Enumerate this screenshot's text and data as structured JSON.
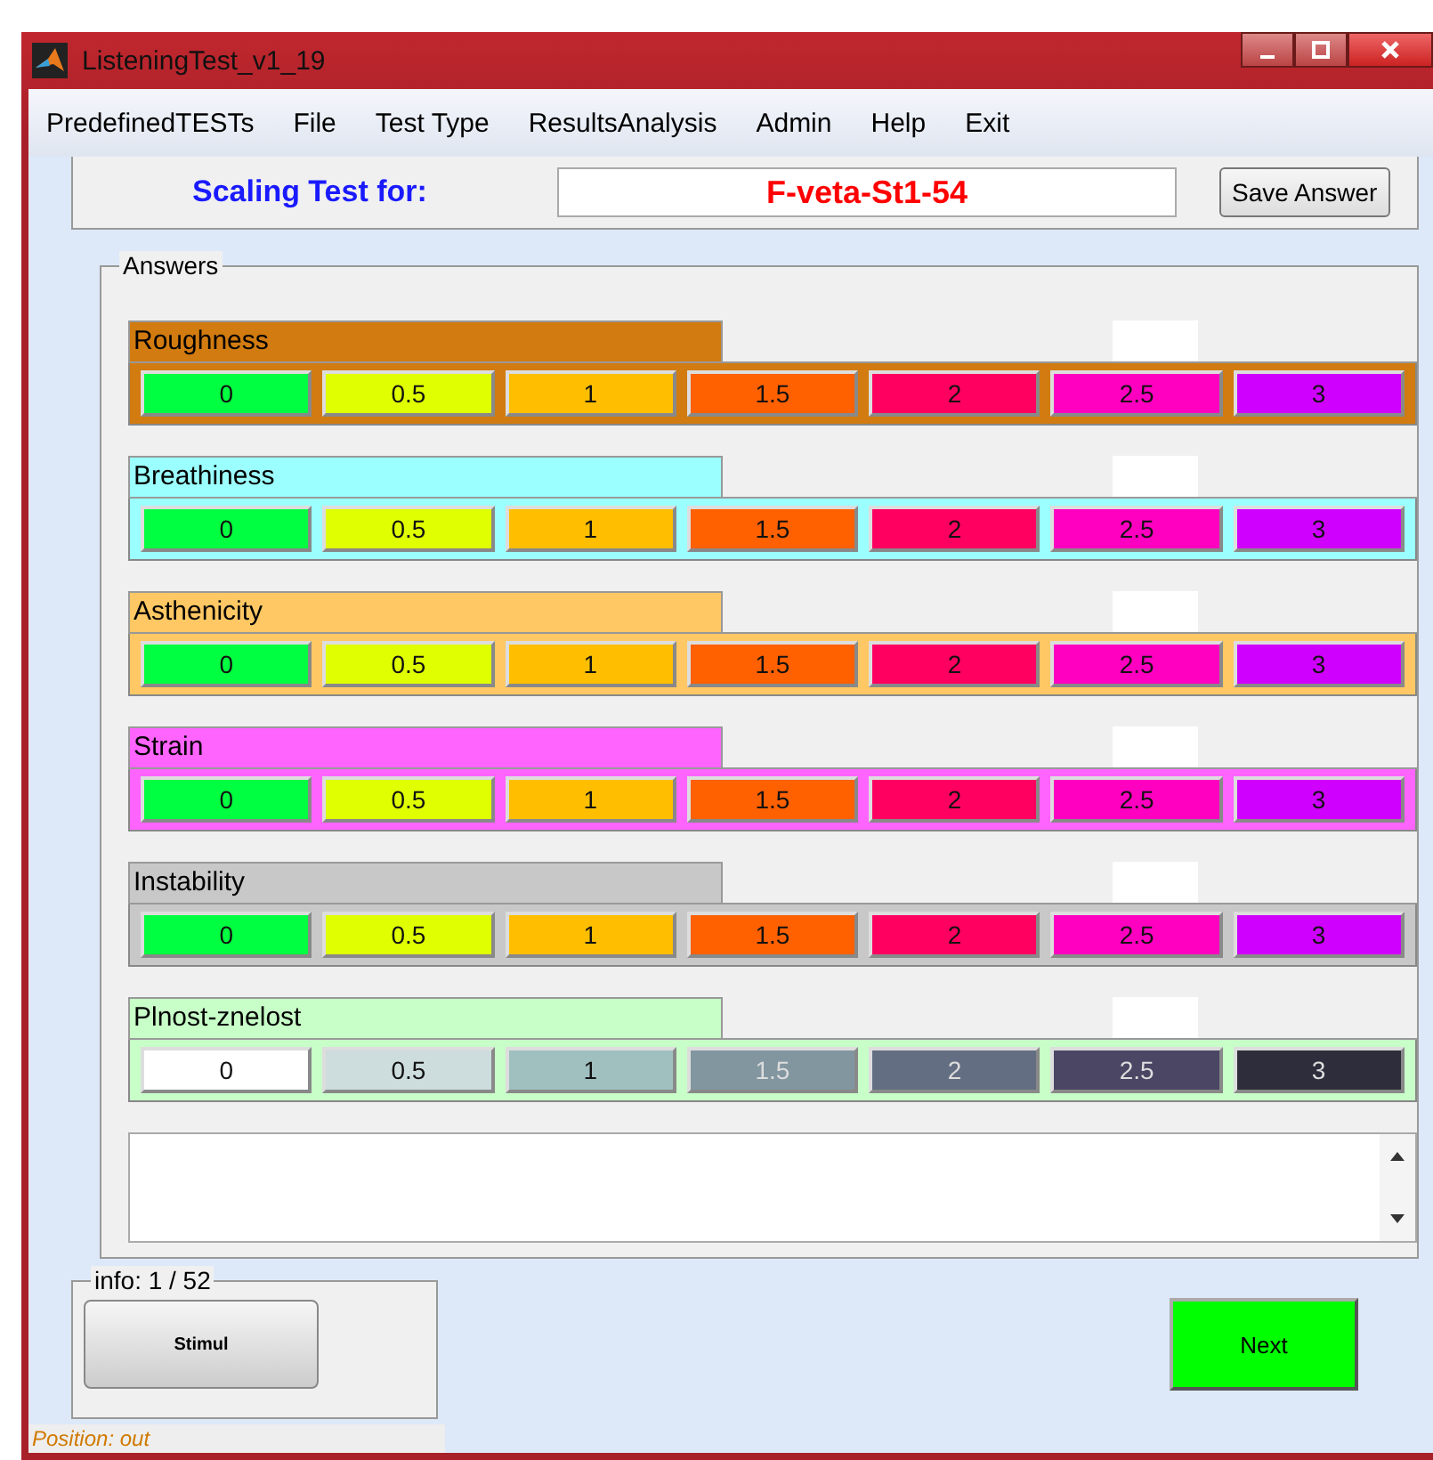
{
  "window": {
    "title": "ListeningTest_v1_19"
  },
  "menu": [
    "PredefinedTESTs",
    "File",
    "Test Type",
    "ResultsAnalysis",
    "Admin",
    "Help",
    "Exit"
  ],
  "general": {
    "label": "Scaling Test for:",
    "value": "F-veta-St1-54",
    "save_button": "Save Answer"
  },
  "answers": {
    "title": "Answers",
    "scales": [
      {
        "name": "Roughness",
        "color": "#d17b10",
        "options": [
          {
            "label": "0",
            "color": "#00ff40"
          },
          {
            "label": "0.5",
            "color": "#e0ff00"
          },
          {
            "label": "1",
            "color": "#ffbf00"
          },
          {
            "label": "1.5",
            "color": "#ff6000"
          },
          {
            "label": "2",
            "color": "#ff0060"
          },
          {
            "label": "2.5",
            "color": "#ff00c0"
          },
          {
            "label": "3",
            "color": "#d000ff"
          }
        ]
      },
      {
        "name": "Breathiness",
        "color": "#9cffff",
        "options": [
          {
            "label": "0",
            "color": "#00ff40"
          },
          {
            "label": "0.5",
            "color": "#e0ff00"
          },
          {
            "label": "1",
            "color": "#ffbf00"
          },
          {
            "label": "1.5",
            "color": "#ff6000"
          },
          {
            "label": "2",
            "color": "#ff0060"
          },
          {
            "label": "2.5",
            "color": "#ff00c0"
          },
          {
            "label": "3",
            "color": "#d000ff"
          }
        ]
      },
      {
        "name": "Asthenicity",
        "color": "#ffc864",
        "options": [
          {
            "label": "0",
            "color": "#00ff40"
          },
          {
            "label": "0.5",
            "color": "#e0ff00"
          },
          {
            "label": "1",
            "color": "#ffbf00"
          },
          {
            "label": "1.5",
            "color": "#ff6000"
          },
          {
            "label": "2",
            "color": "#ff0060"
          },
          {
            "label": "2.5",
            "color": "#ff00c0"
          },
          {
            "label": "3",
            "color": "#d000ff"
          }
        ]
      },
      {
        "name": "Strain",
        "color": "#ff64ff",
        "options": [
          {
            "label": "0",
            "color": "#00ff40"
          },
          {
            "label": "0.5",
            "color": "#e0ff00"
          },
          {
            "label": "1",
            "color": "#ffbf00"
          },
          {
            "label": "1.5",
            "color": "#ff6000"
          },
          {
            "label": "2",
            "color": "#ff0060"
          },
          {
            "label": "2.5",
            "color": "#ff00c0"
          },
          {
            "label": "3",
            "color": "#d000ff"
          }
        ]
      },
      {
        "name": "Instability",
        "color": "#c8c8c8",
        "options": [
          {
            "label": "0",
            "color": "#00ff40"
          },
          {
            "label": "0.5",
            "color": "#e0ff00"
          },
          {
            "label": "1",
            "color": "#ffbf00"
          },
          {
            "label": "1.5",
            "color": "#ff6000"
          },
          {
            "label": "2",
            "color": "#ff0060"
          },
          {
            "label": "2.5",
            "color": "#ff00c0"
          },
          {
            "label": "3",
            "color": "#d000ff"
          }
        ]
      },
      {
        "name": "Plnost-znelost",
        "color": "#c8ffc8",
        "options": [
          {
            "label": "0",
            "color": "#ffffff"
          },
          {
            "label": "0.5",
            "color": "#cddcdc"
          },
          {
            "label": "1",
            "color": "#a0c0c0"
          },
          {
            "label": "1.5",
            "color": "#8296a0"
          },
          {
            "label": "2",
            "color": "#646e82"
          },
          {
            "label": "2.5",
            "color": "#4b4664"
          },
          {
            "label": "3",
            "color": "#2d2d3c"
          }
        ]
      }
    ]
  },
  "info": {
    "title": "info: 1 / 52",
    "button": "Stimul"
  },
  "next_button": "Next",
  "status": "Position: out"
}
